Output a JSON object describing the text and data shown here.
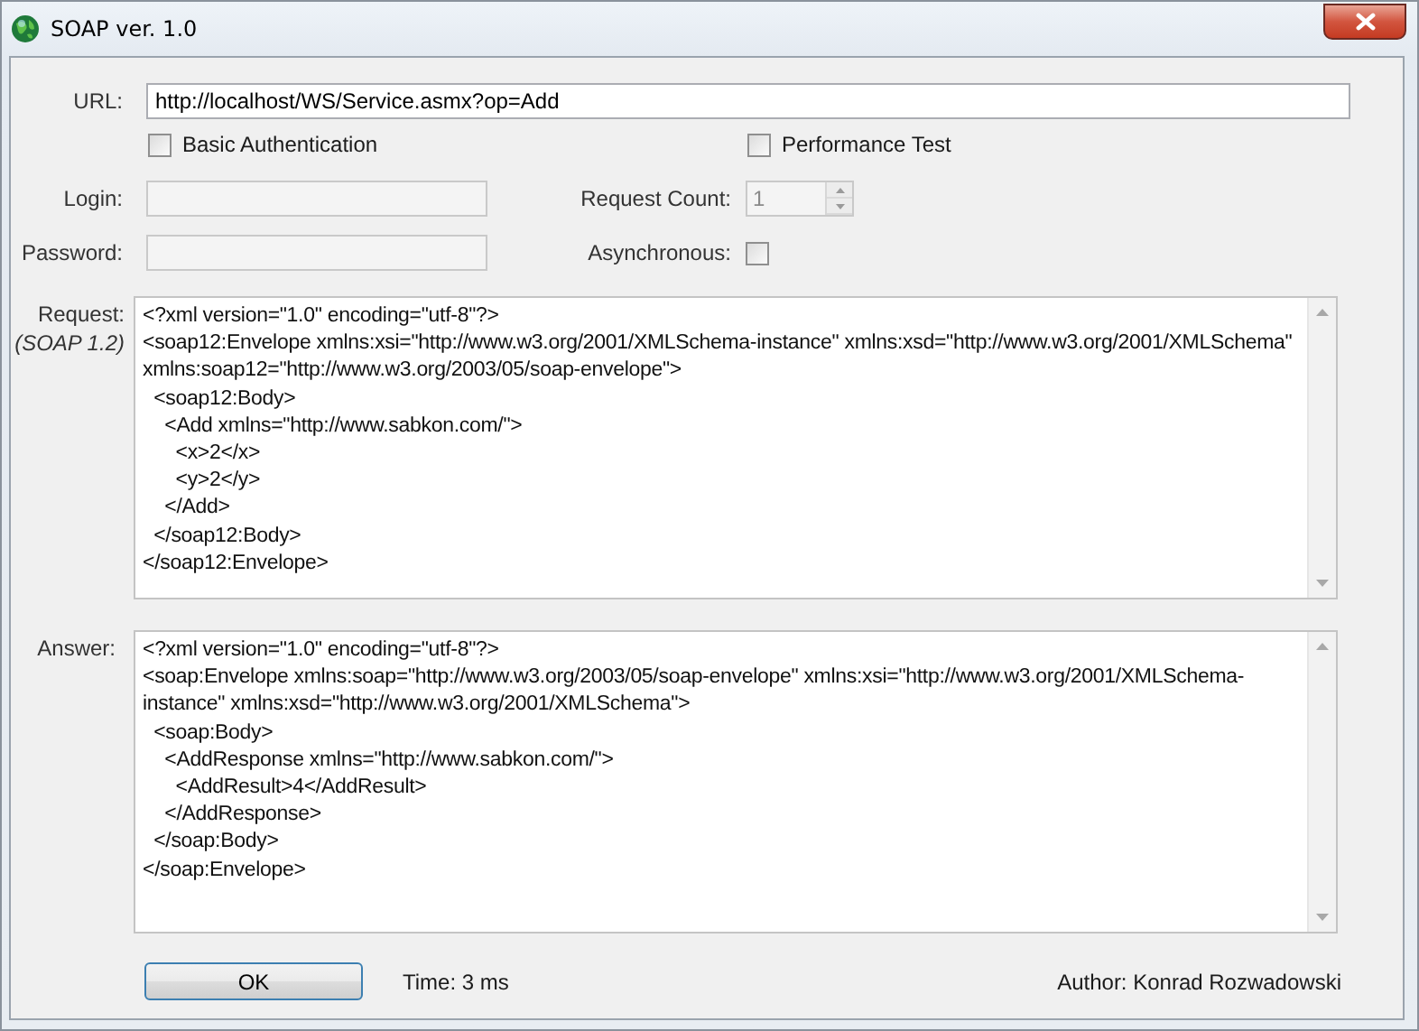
{
  "window": {
    "title": "SOAP ver. 1.0"
  },
  "url": {
    "label": "URL:",
    "value": "http://localhost/WS/Service.asmx?op=Add"
  },
  "options": [
    {
      "label": "Basic Authentication",
      "checked": false
    },
    {
      "label": "Performance Test",
      "checked": false
    }
  ],
  "login": {
    "label": "Login:",
    "disabled": true
  },
  "request_count": {
    "label": "Request Count:",
    "value": "1",
    "disabled": true
  },
  "password": {
    "label": "Password:",
    "disabled": true
  },
  "asynchronous": {
    "label": "Asynchronous:",
    "checked": false
  },
  "request": {
    "label": "Request:",
    "note": "(SOAP 1.2)",
    "lines": [
      "<?xml version=\"1.0\" encoding=\"utf-8\"?>",
      "<soap12:Envelope xmlns:xsi=\"http://www.w3.org/2001/XMLSchema-instance\" xmlns:xsd=\"http://www.w3.org/2001/XMLSchema\"",
      "xmlns:soap12=\"http://www.w3.org/2003/05/soap-envelope\">",
      "  <soap12:Body>",
      "    <Add xmlns=\"http://www.sabkon.com/\">",
      "      <x>2</x>",
      "      <y>2</y>",
      "    </Add>",
      "  </soap12:Body>",
      "</soap12:Envelope>"
    ]
  },
  "answer": {
    "label": "Answer:",
    "lines": [
      "<?xml version=\"1.0\" encoding=\"utf-8\"?>",
      "<soap:Envelope xmlns:soap=\"http://www.w3.org/2003/05/soap-envelope\" xmlns:xsi=\"http://www.w3.org/2001/XMLSchema-",
      "instance\" xmlns:xsd=\"http://www.w3.org/2001/XMLSchema\">",
      "  <soap:Body>",
      "    <AddResponse xmlns=\"http://www.sabkon.com/\">",
      "      <AddResult>4</AddResult>",
      "    </AddResponse>",
      "  </soap:Body>",
      "</soap:Envelope>"
    ]
  },
  "ok_button": "OK",
  "time": "Time: 3 ms",
  "author": "Author: Konrad Rozwadowski"
}
